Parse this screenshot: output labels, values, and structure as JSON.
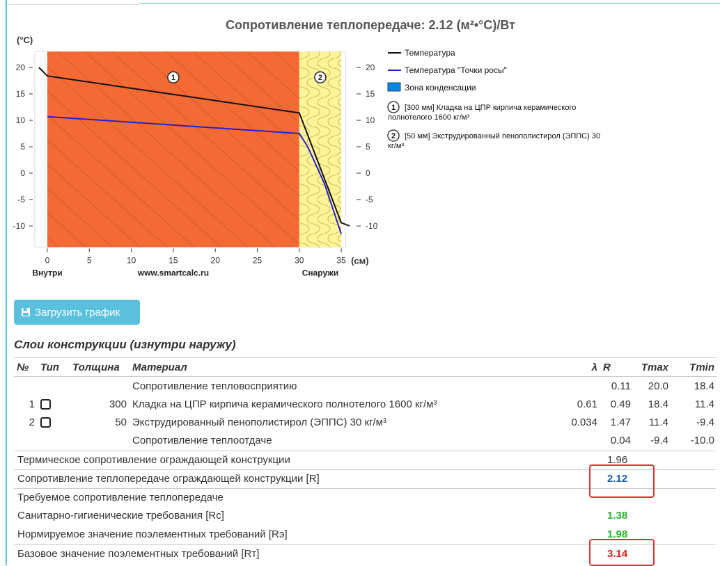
{
  "chart_data": {
    "type": "line",
    "title": "Сопротивление теплопередаче: 2.12 (м²•°С)/Вт",
    "ylabel": "(°С)",
    "xunit": "(см)",
    "xlabel_left": "Внутри",
    "xlabel_center": "www.smartcalc.ru",
    "xlabel_right": "Снаружи",
    "xlim": [
      -1.5,
      35.5
    ],
    "ylim": [
      -14,
      23
    ],
    "xticks": [
      0,
      5,
      10,
      15,
      20,
      25,
      30,
      35
    ],
    "yticks": [
      20,
      15,
      10,
      5,
      0,
      -5,
      -10
    ],
    "layers": [
      {
        "label": "1",
        "x0": 0,
        "x1": 30,
        "fill": "#f46a35"
      },
      {
        "label": "2",
        "x0": 30,
        "x1": 35,
        "fill": "#fff49a"
      }
    ],
    "series": [
      {
        "name": "Температура",
        "color": "#111111",
        "points": [
          [
            -1,
            20
          ],
          [
            0,
            18.4
          ],
          [
            30,
            11.4
          ],
          [
            35,
            -9.4
          ],
          [
            36,
            -10
          ]
        ]
      },
      {
        "name": "Температура \"Точки росы\"",
        "color": "#2222cc",
        "points": [
          [
            0,
            10.7
          ],
          [
            30,
            7.5
          ],
          [
            31,
            5
          ],
          [
            33,
            -2
          ],
          [
            35,
            -11.5
          ]
        ]
      }
    ],
    "legend": [
      {
        "kind": "line",
        "color": "#111111",
        "text": "Температура"
      },
      {
        "kind": "line",
        "color": "#2222cc",
        "text": "Температура \"Точки росы\""
      },
      {
        "kind": "box",
        "color": "#0b84e8",
        "text": "Зона конденсации"
      },
      {
        "kind": "num",
        "num": "1",
        "text": "[300 мм] Кладка на ЦПР кирпича керамического полнотелого 1600 кг/м³"
      },
      {
        "kind": "num",
        "num": "2",
        "text": "[50 мм] Экструдированный пенополистирол (ЭППС) 30 кг/м³"
      }
    ]
  },
  "button": {
    "label": "Загрузить график",
    "icon": "save-chart-icon"
  },
  "section_title": "Слои конструкции (изнутри наружу)",
  "table": {
    "headers": [
      "№",
      "Тип",
      "Толщина",
      "Материал",
      "λ",
      "R",
      "Tmax",
      "Tmin"
    ],
    "rows": [
      {
        "no": "",
        "check": false,
        "thickness": "",
        "material": "Сопротивление тепловосприятию",
        "lambda": "",
        "R": "0.11",
        "tmax": "20.0",
        "tmin": "18.4"
      },
      {
        "no": "1",
        "check": true,
        "thickness": "300",
        "material": "Кладка на ЦПР кирпича керамического полнотелого 1600 кг/м³",
        "lambda": "0.61",
        "R": "0.49",
        "tmax": "18.4",
        "tmin": "11.4"
      },
      {
        "no": "2",
        "check": true,
        "thickness": "50",
        "material": "Экструдированный пенополистирол (ЭППС) 30 кг/м³",
        "lambda": "0.034",
        "R": "1.47",
        "tmax": "11.4",
        "tmin": "-9.4"
      },
      {
        "no": "",
        "check": false,
        "thickness": "",
        "material": "Сопротивление теплоотдаче",
        "lambda": "",
        "R": "0.04",
        "tmax": "-9.4",
        "tmin": "-10.0"
      }
    ]
  },
  "summary": [
    {
      "label": "Термическое сопротивление ограждающей конструкции",
      "value": "1.96",
      "style": ""
    },
    {
      "label": "Сопротивление теплопередаче ограждающей конструкции [R]",
      "value": "2.12",
      "style": "blue"
    },
    {
      "label": "Требуемое сопротивление теплопередаче",
      "value": "",
      "style": ""
    },
    {
      "label": "Санитарно-гигиенические требования [Rc]",
      "value": "1.38",
      "style": "green"
    },
    {
      "label": "Нормируемое значение поэлементных требований [Rэ]",
      "value": "1.98",
      "style": "green"
    },
    {
      "label": "Базовое значение поэлементных требований [Rт]",
      "value": "3.14",
      "style": "red"
    }
  ]
}
